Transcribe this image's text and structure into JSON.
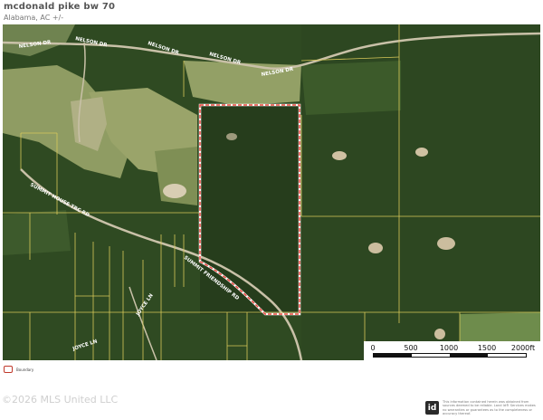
{
  "header": {
    "title": "mcdonald pike bw 70",
    "subtitle": "Alabama,  AC +/-"
  },
  "map": {
    "road_labels": {
      "nelson_dr_1": "NELSON DR",
      "nelson_dr_2": "NELSON DR",
      "nelson_dr_3": "NELSON DR",
      "nelson_dr_4": "NELSON DR",
      "nelson_dr_5": "NELSON DR",
      "summit_house": "SUMMIT HOUSE TRC RD",
      "summit_friendship": "SUMMIT FRIENDSHIP RD",
      "joyce_ln_1": "JOYCE LN",
      "joyce_ln_2": "JOYCE LN"
    },
    "colors": {
      "boundary": "#e8463c",
      "forest": "#2f4a22",
      "field": "#8d9a62",
      "parcel_line": "#d9c95a"
    }
  },
  "scalebar": {
    "ticks": [
      "0",
      "500",
      "1000",
      "1500",
      "2000ft"
    ]
  },
  "legend": {
    "label": "Boundary"
  },
  "footer": {
    "copyright": "©2026 MLS United LLC",
    "logo_text": "id",
    "disclaimer": "This information contained herein was obtained from sources deemed to be reliable. Land Id® Services makes no warranties or guarantees as to the completeness or accuracy thereof."
  }
}
